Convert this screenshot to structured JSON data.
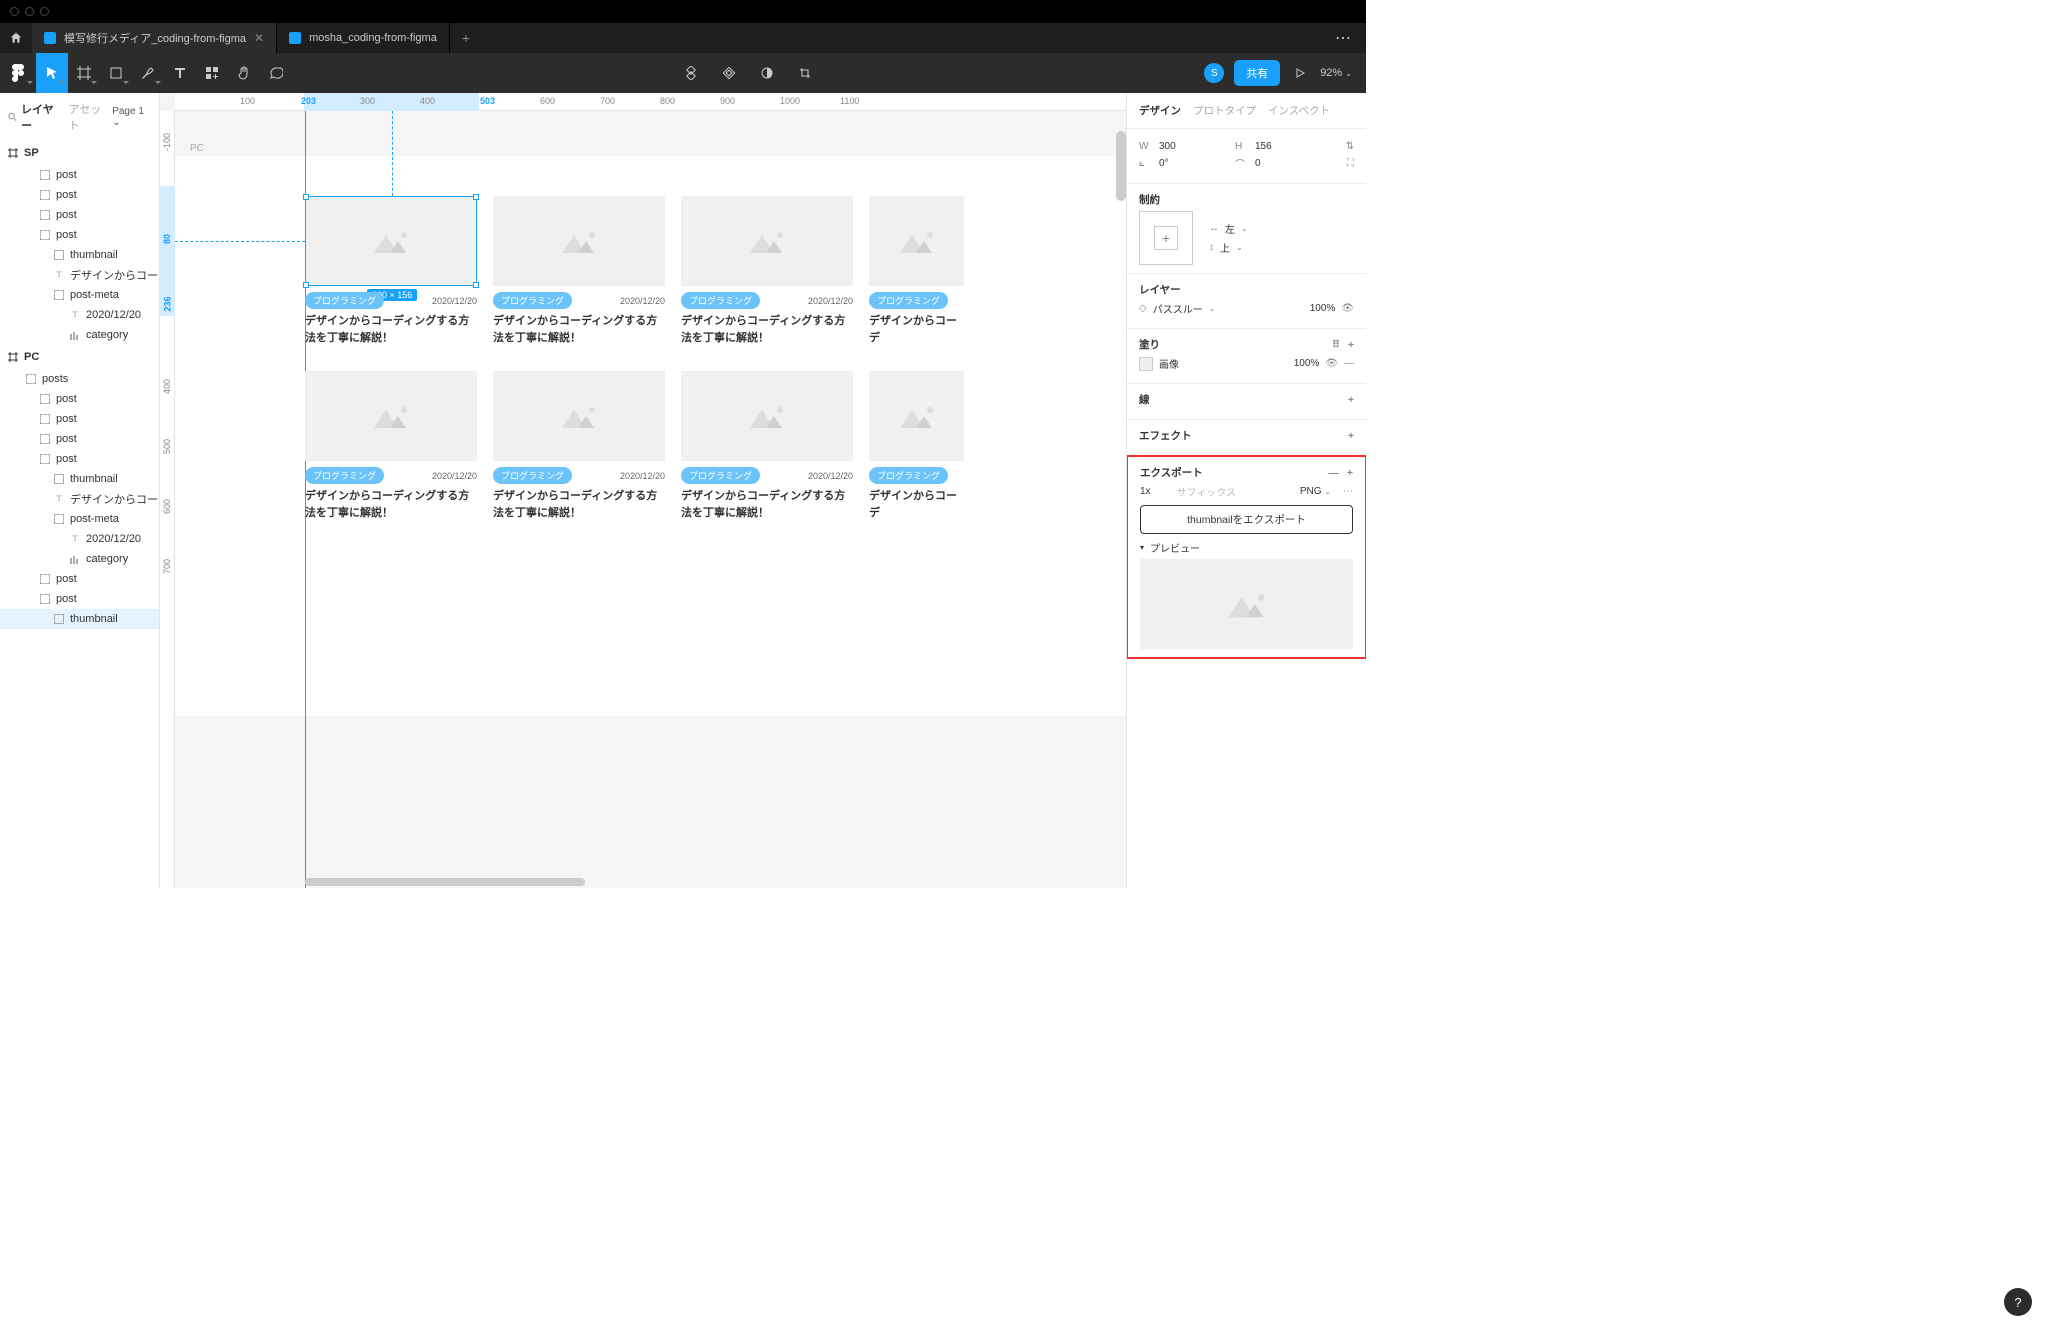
{
  "tabs": [
    {
      "label": "模写修行メディア_coding-from-figma",
      "active": true
    },
    {
      "label": "mosha_coding-from-figma",
      "active": false
    }
  ],
  "toolbar": {
    "avatar": "S",
    "share": "共有",
    "zoom": "92%"
  },
  "left": {
    "layers": "レイヤー",
    "assets": "アセット",
    "page": "Page 1",
    "frame_sp": "SP",
    "frame_pc": "PC",
    "items_sp": [
      "post",
      "post",
      "post",
      "post"
    ],
    "post_children": [
      "thumbnail",
      "デザインからコーディ...",
      "post-meta",
      "2020/12/20",
      "category"
    ],
    "posts": "posts",
    "items_pc": [
      "post",
      "post",
      "post",
      "post"
    ],
    "pc_extra": [
      "post",
      "post"
    ],
    "sel": "thumbnail"
  },
  "ruler_h": {
    "vals": [
      "100",
      "203",
      "300",
      "400",
      "503",
      "600",
      "700",
      "800",
      "900",
      "1000",
      "1100"
    ]
  },
  "ruler_v": {
    "vals": [
      "-100",
      "80",
      "236",
      "400",
      "500",
      "600",
      "700"
    ]
  },
  "canvas": {
    "frame_label": "PC",
    "dim": "300 × 156",
    "tag": "プログラミング",
    "date": "2020/12/20",
    "title": "デザインからコーディングする方法を丁寧に解説！",
    "title_clip": "デザインからコーデ"
  },
  "right": {
    "tabs": [
      "デザイン",
      "プロトタイプ",
      "インスペクト"
    ],
    "w": "300",
    "h": "156",
    "angle": "0°",
    "radius": "0",
    "constraint": "制約",
    "c_h": "左",
    "c_v": "上",
    "layer": "レイヤー",
    "pass": "パススルー",
    "opacity": "100%",
    "fill": "塗り",
    "fill_type": "画像",
    "fill_op": "100%",
    "stroke": "線",
    "effect": "エフェクト",
    "export": "エクスポート",
    "scale": "1x",
    "suffix": "サフィックス",
    "format": "PNG",
    "export_btn": "thumbnailをエクスポート",
    "preview": "プレビュー"
  }
}
